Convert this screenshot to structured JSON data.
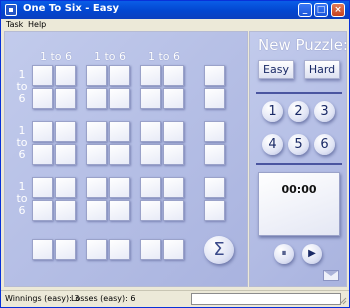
{
  "window": {
    "title": "One To Six - Easy",
    "min_label": "_",
    "max_label": "□",
    "close_label": "×"
  },
  "menu": {
    "items": [
      "Task",
      "Help"
    ]
  },
  "board": {
    "column_headers": [
      "1 to 6",
      "1 to 6",
      "1 to 6"
    ],
    "row_labels": [
      [
        "1",
        "to",
        "6"
      ],
      [
        "1",
        "to",
        "6"
      ],
      [
        "1",
        "to",
        "6"
      ]
    ],
    "sum_symbol": "Σ"
  },
  "panel": {
    "new_puzzle_title": "New Puzzle:",
    "difficulty_buttons": [
      "Easy",
      "Hard"
    ],
    "number_buttons": [
      "1",
      "2",
      "3",
      "4",
      "5",
      "6"
    ],
    "timer": "00:00",
    "pause_symbol": "⏸",
    "play_symbol": "▶"
  },
  "status": {
    "winnings": "Winnings (easy):  3",
    "losses": "Losses (easy):  6"
  },
  "colors": {
    "board_bg": "#b8c1e6",
    "accent": "#4a55a0",
    "titlebar": "#0a4ed8"
  }
}
